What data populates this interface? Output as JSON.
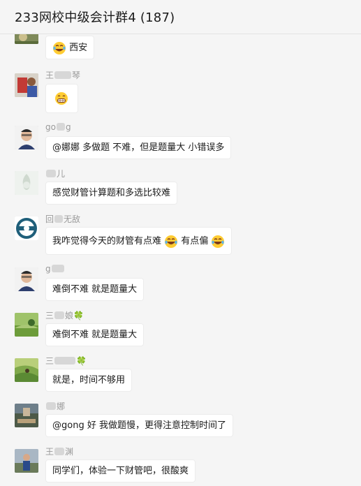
{
  "header": {
    "title": "233网校中级会计群4 (187)"
  },
  "messages": [
    {
      "sender": "",
      "text": "西安",
      "emoji_before": "laugh-tears-emoji"
    },
    {
      "sender_a": "王",
      "sender_b": "琴",
      "text": "",
      "emoji_only": "grin-emoji"
    },
    {
      "sender_a": "go",
      "sender_b": "g",
      "text": "@娜娜 多做题 不难，但是题量大 小错误多"
    },
    {
      "sender_a": "",
      "sender_b": "儿",
      "text": "感觉财管计算题和多选比较难"
    },
    {
      "sender_a": "回",
      "sender_b": "无敌",
      "text": "我咋觉得今天的财管有点难",
      "text2": "有点偏",
      "emoji_after": "laugh-tears-emoji"
    },
    {
      "sender_a": "g",
      "sender_b": "",
      "text": "难倒不难 就是题量大"
    },
    {
      "sender_a": "三",
      "sender_b": "娘",
      "text": "难倒不难 就是题量大",
      "clover": "🍀"
    },
    {
      "sender_a": "三",
      "sender_b": "",
      "text": "就是，时间不够用",
      "clover": "🍀"
    },
    {
      "sender_a": "",
      "sender_b": "娜",
      "text": "@gong 好  我做题慢，更得注意控制时间了"
    },
    {
      "sender_a": "王",
      "sender_b": "渊",
      "text": "同学们，体验一下财管吧，很酸爽"
    }
  ]
}
